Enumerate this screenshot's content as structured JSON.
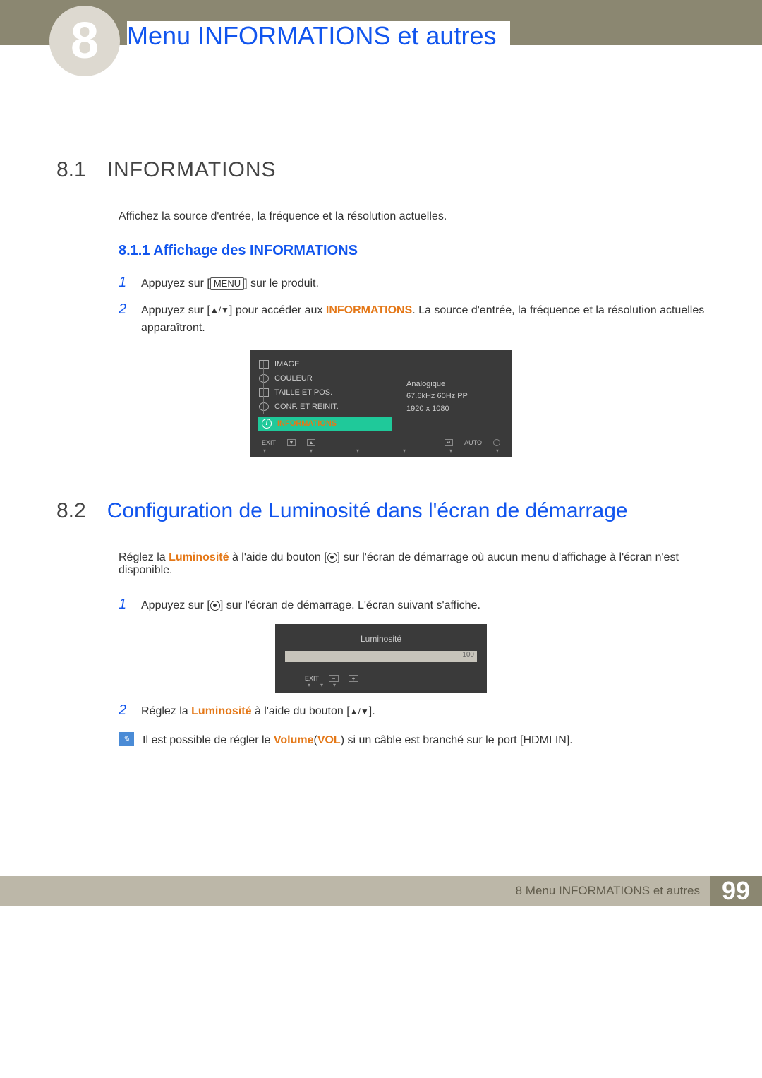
{
  "header": {
    "chapter_number": "8",
    "title": "Menu INFORMATIONS et autres"
  },
  "section_8_1": {
    "num": "8.1",
    "title": "INFORMATIONS",
    "desc": "Affichez la source d'entrée, la fréquence et la résolution actuelles.",
    "sub": {
      "num_title": "8.1.1  Affichage des INFORMATIONS",
      "step1_pre": "Appuyez sur [",
      "step1_btn": "MENU",
      "step1_post": "] sur le produit.",
      "step2_pre": "Appuyez sur [",
      "step2_arrows": "▲/▼",
      "step2_mid": "] pour accéder aux ",
      "step2_hl": "INFORMATIONS",
      "step2_post": ". La source d'entrée, la fréquence et la résolution actuelles apparaîtront."
    }
  },
  "osd": {
    "items": {
      "image": "IMAGE",
      "couleur": "COULEUR",
      "taille": "TAILLE ET POS.",
      "conf": "CONF. ET REINIT.",
      "info": "INFORMATIONS"
    },
    "info_panel": {
      "source": "Analogique",
      "freq": "67.6kHz 60Hz PP",
      "res": "1920 x 1080"
    },
    "bottom": {
      "exit": "EXIT",
      "auto": "AUTO"
    }
  },
  "section_8_2": {
    "num": "8.2",
    "title": "Configuration de Luminosité dans l'écran de démarrage",
    "desc_pre": "Réglez la ",
    "desc_hl": "Luminosité",
    "desc_mid": " à l'aide du bouton [",
    "desc_post": "] sur l'écran de démarrage où aucun menu d'affichage à l'écran n'est disponible.",
    "step1_pre": "Appuyez sur [",
    "step1_post": "] sur l'écran de démarrage. L'écran suivant s'affiche.",
    "step2_pre": "Réglez la ",
    "step2_hl": "Luminosité",
    "step2_mid": " à l'aide du bouton [",
    "step2_arrows": "▲/▼",
    "step2_post": "]."
  },
  "brightness_box": {
    "title": "Luminosité",
    "value": "100",
    "exit": "EXIT"
  },
  "note": {
    "text_pre": "Il est possible de régler le ",
    "text_hl1": "Volume",
    "text_paren_pre": "(",
    "text_hl2": "VOL",
    "text_paren_post": ")",
    "text_post": " si un câble est branché sur le port [HDMI IN]."
  },
  "footer": {
    "text": "8 Menu INFORMATIONS et autres",
    "page": "99"
  }
}
